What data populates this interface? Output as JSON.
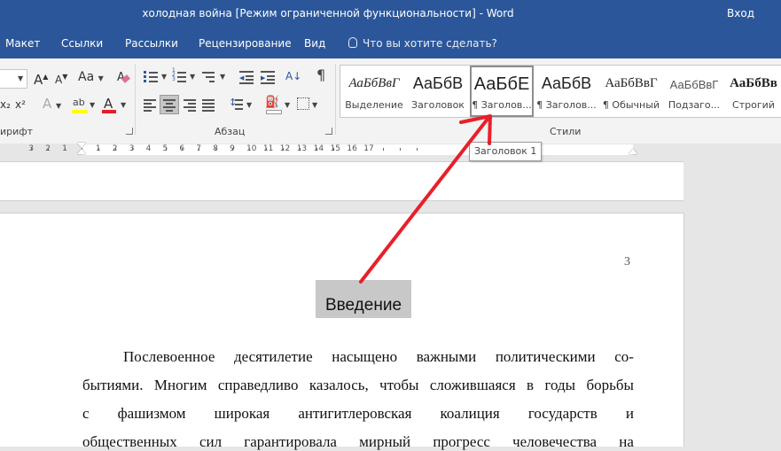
{
  "window": {
    "title": "холодная война [Режим ограниченной функциональности]  -  Word",
    "signin": "Вход"
  },
  "tabs": [
    "Макет",
    "Ссылки",
    "Рассылки",
    "Рецензирование",
    "Вид"
  ],
  "tell_me": "Что вы хотите сделать?",
  "ribbon": {
    "font_group": "ирифт",
    "paragraph_group": "Абзац",
    "styles_group": "Стили",
    "font_buttons": {
      "grow": "A",
      "case": "Aa",
      "effects": "A",
      "color": "A",
      "sub": "x₂",
      "sup": "x²"
    },
    "pilcrow": "¶"
  },
  "styles": [
    {
      "sample": "АаБбВвГ",
      "name": "Выделение"
    },
    {
      "sample": "АаБбВ",
      "name": "Заголовок"
    },
    {
      "sample": "АаБбЕ",
      "name": "¶ Заголов..."
    },
    {
      "sample": "АаБбВ",
      "name": "¶ Заголов..."
    },
    {
      "sample": "АаБбВвГ",
      "name": "¶ Обычный"
    },
    {
      "sample": "АаБбВвГ",
      "name": "Подзаго..."
    },
    {
      "sample": "АаБбВв",
      "name": "Строгий"
    }
  ],
  "tooltip": "Заголовок 1",
  "ruler": [
    "3",
    "2",
    "1",
    "1",
    "2",
    "3",
    "4",
    "5",
    "6",
    "7",
    "8",
    "9",
    "10",
    "11",
    "12",
    "13",
    "14",
    "15",
    "16",
    "17"
  ],
  "document": {
    "page_number": "3",
    "heading": "Введение",
    "lines": [
      [
        "Послевоенное",
        "десятилетие",
        "насыщено",
        "важными",
        "политическими",
        "со-"
      ],
      [
        "бытиями.",
        "Многим",
        "справедливо",
        "казалось,",
        "чтобы",
        "сложившаяся",
        "в",
        "годы",
        "борьбы"
      ],
      [
        "с",
        "фашизмом",
        "широкая",
        "антигитлеровская",
        "коалиция",
        "государств",
        "и"
      ],
      [
        "общественных",
        "сил",
        "гарантировала",
        "мирный",
        "прогресс",
        "человечества",
        "на"
      ]
    ]
  },
  "colors": {
    "accent": "#2b579a",
    "arrow": "#e8202a"
  }
}
